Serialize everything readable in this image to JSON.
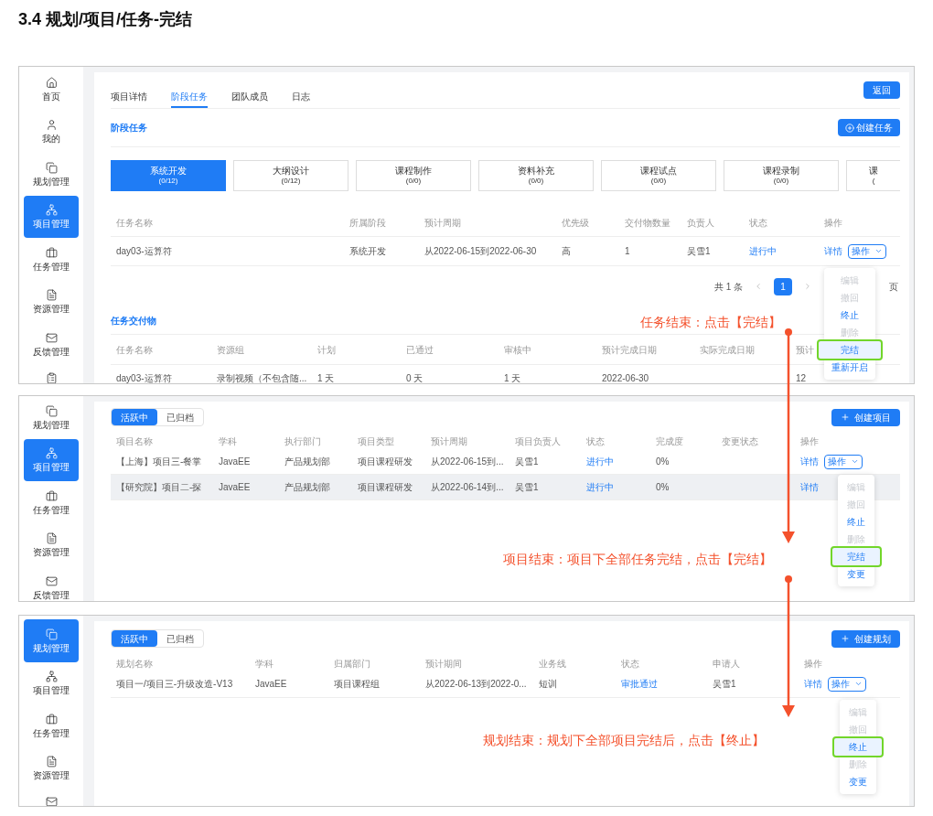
{
  "heading": "3.4 规划/项目/任务-完结",
  "task_screen": {
    "sidebar": [
      {
        "kind": "home",
        "label": "首页",
        "selected": false
      },
      {
        "kind": "user",
        "label": "我的",
        "selected": false
      },
      {
        "kind": "plan",
        "label": "规划管理",
        "selected": false
      },
      {
        "kind": "project",
        "label": "项目管理",
        "selected": true
      },
      {
        "kind": "task",
        "label": "任务管理",
        "selected": false
      },
      {
        "kind": "resource",
        "label": "资源管理",
        "selected": false
      },
      {
        "kind": "feedback",
        "label": "反馈管理",
        "selected": false
      },
      {
        "kind": "report",
        "selected": false
      }
    ],
    "tabs": [
      {
        "label": "项目详情",
        "selected": false
      },
      {
        "label": "阶段任务",
        "selected": true
      },
      {
        "label": "团队成员",
        "selected": false
      },
      {
        "label": "日志",
        "selected": false
      }
    ],
    "back_button": "返回",
    "section_title": "阶段任务",
    "create_button": "创建任务",
    "stages": [
      {
        "name": "系统开发",
        "count": "(0/12)",
        "selected": true
      },
      {
        "name": "大纲设计",
        "count": "(0/12)",
        "selected": false
      },
      {
        "name": "课程制作",
        "count": "(0/0)",
        "selected": false
      },
      {
        "name": "资料补充",
        "count": "(0/0)",
        "selected": false
      },
      {
        "name": "课程试点",
        "count": "(0/0)",
        "selected": false
      },
      {
        "name": "课程录制",
        "count": "(0/0)",
        "selected": false
      },
      {
        "name": "课",
        "count": "(",
        "selected": false
      }
    ],
    "table": {
      "columns": [
        "任务名称",
        "所属阶段",
        "预计周期",
        "优先级",
        "交付物数量",
        "负责人",
        "状态",
        "操作"
      ],
      "rows": [
        {
          "hovered": false,
          "cells": [
            "day03-运算符",
            "系统开发",
            "从2022-06-15到2022-06-30",
            "高",
            "1",
            "吴雪1",
            {
              "kind": "status",
              "text": "进行中"
            },
            {
              "kind": "actions",
              "detail": "详情",
              "menu_button": "操作"
            }
          ]
        }
      ]
    },
    "pagination": {
      "total": "共 1 条",
      "pages": [
        {
          "label": "1",
          "selected": true
        }
      ],
      "suffix": "页"
    },
    "deliverables_title": "任务交付物",
    "deliverables": {
      "columns": [
        "任务名称",
        "资源组",
        "计划",
        "已通过",
        "审核中",
        "预计完成日期",
        "实际完成日期",
        "预计"
      ],
      "rows": [
        {
          "hovered": false,
          "cells": [
            "day03-运算符",
            "录制视频（不包含随...",
            "1 天",
            "0 天",
            "1 天",
            "2022-06-30",
            "",
            "12"
          ]
        }
      ]
    },
    "menu": [
      {
        "label": "编辑",
        "disabled": true,
        "highlighted": false
      },
      {
        "label": "撤回",
        "disabled": true,
        "highlighted": false
      },
      {
        "label": "终止",
        "disabled": false,
        "highlighted": false
      },
      {
        "label": "删除",
        "disabled": true,
        "highlighted": false
      },
      {
        "label": "完结",
        "disabled": false,
        "highlighted": true
      },
      {
        "label": "重新开启",
        "disabled": false,
        "highlighted": false
      }
    ]
  },
  "project_screen": {
    "sidebar": [
      {
        "kind": "plan",
        "label": "规划管理",
        "selected": false
      },
      {
        "kind": "project",
        "label": "项目管理",
        "selected": true
      },
      {
        "kind": "task",
        "label": "任务管理",
        "selected": false
      },
      {
        "kind": "resource",
        "label": "资源管理",
        "selected": false
      },
      {
        "kind": "feedback",
        "label": "反馈管理",
        "selected": false
      }
    ],
    "filters": [
      {
        "label": "活跃中",
        "selected": true
      },
      {
        "label": "已归档",
        "selected": false
      }
    ],
    "create_button": "创建项目",
    "table": {
      "columns": [
        "项目名称",
        "学科",
        "执行部门",
        "项目类型",
        "预计周期",
        "项目负责人",
        "状态",
        "完成度",
        "变更状态",
        "操作"
      ],
      "rows": [
        {
          "hovered": false,
          "cells": [
            "【上海】项目三-餐掌",
            "JavaEE",
            "产品规划部",
            "项目课程研发",
            "从2022-06-15到...",
            "吴雪1",
            {
              "kind": "status",
              "text": "进行中"
            },
            "0%",
            "",
            {
              "kind": "actions",
              "detail": "详情",
              "menu_button": "操作"
            }
          ]
        },
        {
          "hovered": true,
          "cells": [
            "【研究院】项目二-探",
            "JavaEE",
            "产品规划部",
            "项目课程研发",
            "从2022-06-14到...",
            "吴雪1",
            {
              "kind": "status",
              "text": "进行中"
            },
            "0%",
            "",
            {
              "kind": "actions",
              "detail": "详情"
            }
          ]
        }
      ]
    },
    "menu": [
      {
        "label": "编辑",
        "disabled": true,
        "highlighted": false
      },
      {
        "label": "撤回",
        "disabled": true,
        "highlighted": false
      },
      {
        "label": "终止",
        "disabled": false,
        "highlighted": false
      },
      {
        "label": "删除",
        "disabled": true,
        "highlighted": false
      },
      {
        "label": "完结",
        "disabled": false,
        "highlighted": true
      },
      {
        "label": "变更",
        "disabled": false,
        "highlighted": false
      }
    ]
  },
  "plan_screen": {
    "sidebar": [
      {
        "kind": "plan",
        "label": "规划管理",
        "selected": true
      },
      {
        "kind": "project",
        "label": "项目管理",
        "selected": false
      },
      {
        "kind": "task",
        "label": "任务管理",
        "selected": false
      },
      {
        "kind": "resource",
        "label": "资源管理",
        "selected": false
      },
      {
        "kind": "feedback",
        "selected": false
      }
    ],
    "filters": [
      {
        "label": "活跃中",
        "selected": true
      },
      {
        "label": "已归档",
        "selected": false
      }
    ],
    "create_button": "创建规划",
    "table": {
      "columns": [
        "规划名称",
        "学科",
        "归属部门",
        "预计期间",
        "业务线",
        "状态",
        "申请人",
        "操作"
      ],
      "rows": [
        {
          "hovered": false,
          "cells": [
            "项目一/项目三-升级改造-V13",
            "JavaEE",
            "项目课程组",
            "从2022-06-13到2022-0...",
            "短训",
            {
              "kind": "status",
              "text": "审批通过"
            },
            "吴雪1",
            {
              "kind": "actions",
              "detail": "详情",
              "menu_button": "操作"
            }
          ]
        }
      ]
    },
    "menu": [
      {
        "label": "编辑",
        "disabled": true,
        "highlighted": false
      },
      {
        "label": "撤回",
        "disabled": true,
        "highlighted": false
      },
      {
        "label": "终止",
        "disabled": false,
        "highlighted": true
      },
      {
        "label": "删除",
        "disabled": true,
        "highlighted": false
      },
      {
        "label": "变更",
        "disabled": false,
        "highlighted": false
      }
    ]
  },
  "annotations": [
    "任务结束：点击【完结】",
    "项目结束：项目下全部任务完结，点击【完结】",
    "规划结束：规划下全部项目完结后，点击【终止】"
  ]
}
